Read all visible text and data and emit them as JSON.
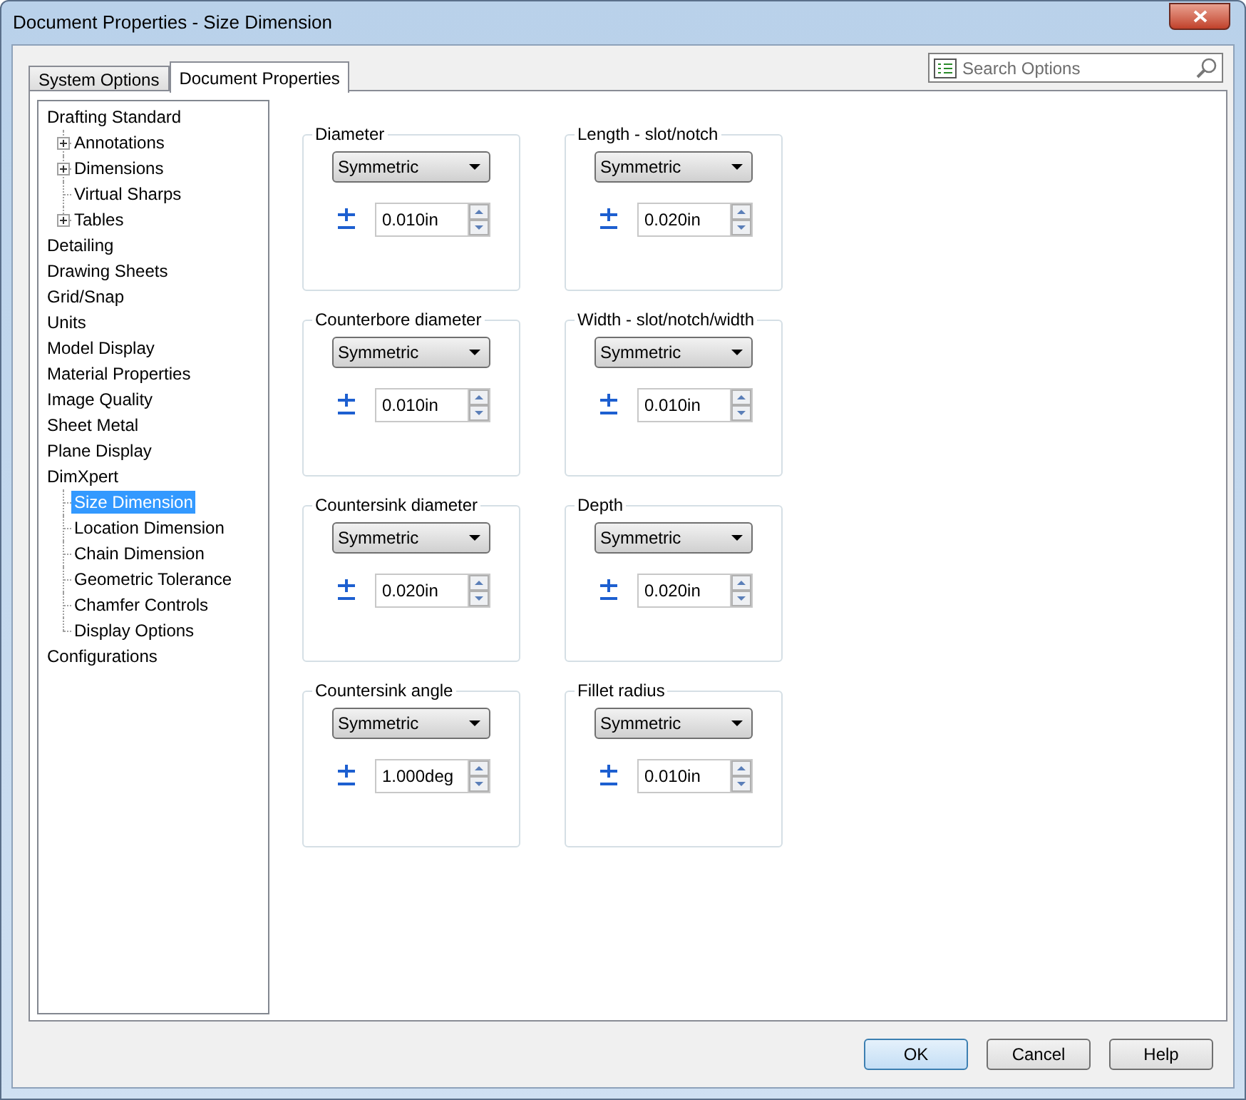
{
  "window": {
    "title": "Document Properties - Size Dimension"
  },
  "tabs": [
    {
      "label": "System Options",
      "selected": false
    },
    {
      "label": "Document Properties",
      "selected": true
    }
  ],
  "search": {
    "placeholder": "Search Options"
  },
  "tree": [
    {
      "label": "Drafting Standard",
      "selected": false,
      "expanded": true,
      "children": [
        {
          "label": "Annotations",
          "selected": false,
          "expanded": false
        },
        {
          "label": "Dimensions",
          "selected": false,
          "expanded": false
        },
        {
          "label": "Virtual Sharps",
          "selected": false
        },
        {
          "label": "Tables",
          "selected": false,
          "expanded": false
        }
      ]
    },
    {
      "label": "Detailing",
      "selected": false
    },
    {
      "label": "Drawing Sheets",
      "selected": false
    },
    {
      "label": "Grid/Snap",
      "selected": false
    },
    {
      "label": "Units",
      "selected": false
    },
    {
      "label": "Model Display",
      "selected": false
    },
    {
      "label": "Material Properties",
      "selected": false
    },
    {
      "label": "Image Quality",
      "selected": false
    },
    {
      "label": "Sheet Metal",
      "selected": false
    },
    {
      "label": "Plane Display",
      "selected": false
    },
    {
      "label": "DimXpert",
      "selected": false,
      "expanded": true,
      "children": [
        {
          "label": "Size Dimension",
          "selected": true
        },
        {
          "label": "Location Dimension",
          "selected": false
        },
        {
          "label": "Chain Dimension",
          "selected": false
        },
        {
          "label": "Geometric Tolerance",
          "selected": false
        },
        {
          "label": "Chamfer Controls",
          "selected": false
        },
        {
          "label": "Display Options",
          "selected": false
        }
      ]
    },
    {
      "label": "Configurations",
      "selected": false
    }
  ],
  "groups": [
    {
      "label": "Diameter",
      "mode": "Symmetric",
      "value": "0.010in"
    },
    {
      "label": "Length - slot/notch",
      "mode": "Symmetric",
      "value": "0.020in"
    },
    {
      "label": "Counterbore diameter",
      "mode": "Symmetric",
      "value": "0.010in"
    },
    {
      "label": "Width - slot/notch/width",
      "mode": "Symmetric",
      "value": "0.010in"
    },
    {
      "label": "Countersink diameter",
      "mode": "Symmetric",
      "value": "0.020in"
    },
    {
      "label": "Depth",
      "mode": "Symmetric",
      "value": "0.020in"
    },
    {
      "label": "Countersink angle",
      "mode": "Symmetric",
      "value": "1.000deg"
    },
    {
      "label": "Fillet radius",
      "mode": "Symmetric",
      "value": "0.010in"
    }
  ],
  "buttons": [
    {
      "label": "OK",
      "default": true
    },
    {
      "label": "Cancel",
      "default": false
    },
    {
      "label": "Help",
      "default": false
    }
  ]
}
